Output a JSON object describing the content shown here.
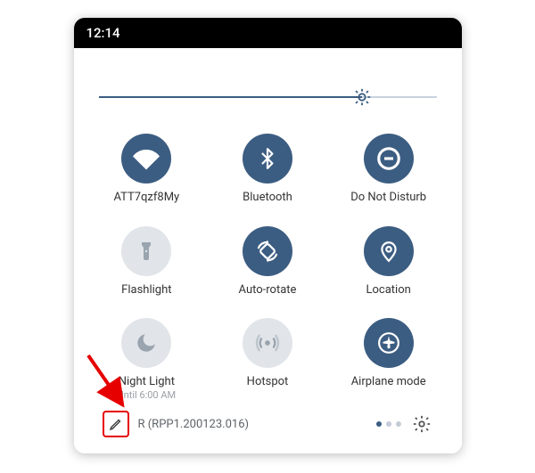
{
  "status": {
    "time": "12:14"
  },
  "brightness": {
    "value_percent": 78
  },
  "tiles": [
    {
      "label": "ATT7qzf8My",
      "sub": "",
      "icon": "wifi",
      "state": "on"
    },
    {
      "label": "Bluetooth",
      "sub": "",
      "icon": "bluetooth",
      "state": "on"
    },
    {
      "label": "Do Not Disturb",
      "sub": "",
      "icon": "dnd",
      "state": "on"
    },
    {
      "label": "Flashlight",
      "sub": "",
      "icon": "flashlight",
      "state": "off"
    },
    {
      "label": "Auto-rotate",
      "sub": "",
      "icon": "rotate",
      "state": "on"
    },
    {
      "label": "Location",
      "sub": "",
      "icon": "location",
      "state": "on"
    },
    {
      "label": "Night Light",
      "sub": "Until 6:00 AM",
      "icon": "moon",
      "state": "off"
    },
    {
      "label": "Hotspot",
      "sub": "",
      "icon": "hotspot",
      "state": "off"
    },
    {
      "label": "Airplane mode",
      "sub": "",
      "icon": "airplane",
      "state": "on"
    }
  ],
  "footer": {
    "build": "R (RPP1.200123.016)"
  },
  "colors": {
    "accent": "#3c5d82",
    "muted": "#e1e5e9",
    "annot": "#e60000"
  }
}
